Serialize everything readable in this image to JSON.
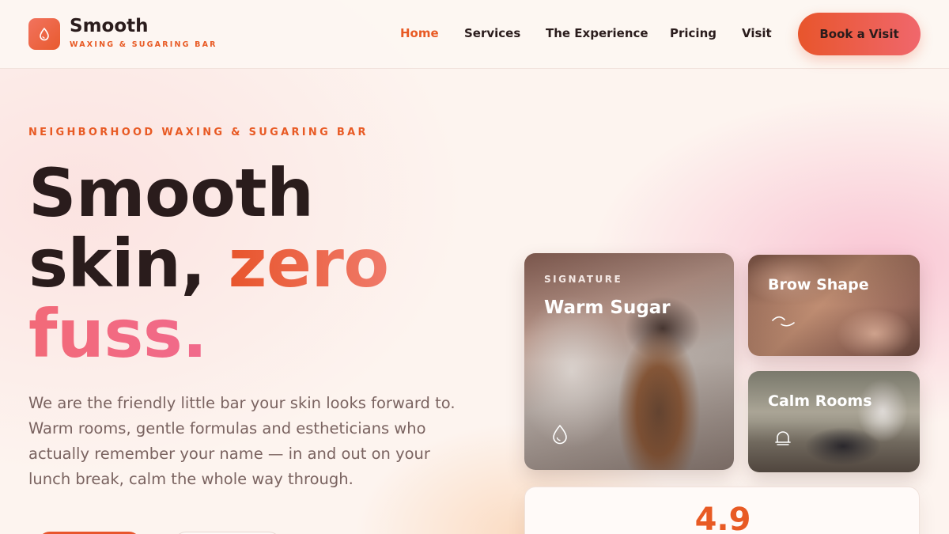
{
  "brand": {
    "name": "Smooth",
    "tagline": "WAXING & SUGARING BAR",
    "icon": "water-drop-icon"
  },
  "nav": {
    "items": [
      {
        "label": "Home",
        "active": true
      },
      {
        "label": "Services",
        "active": false
      },
      {
        "label": "The Experience",
        "active": false
      },
      {
        "label": "Pricing",
        "active": false
      },
      {
        "label": "Visit",
        "active": false
      }
    ],
    "cta_label": "Book a Visit"
  },
  "hero": {
    "eyebrow": "NEIGHBORHOOD WAXING & SUGARING BAR",
    "title_line1": "Smooth",
    "title_line2_a": "skin, ",
    "title_line2_b": "zero",
    "title_line3": "fuss.",
    "description": "We are the friendly little bar your skin looks forward to. Warm rooms, gentle formulas and estheticians who actually remember your name — in and out on your lunch break, calm the whole way through."
  },
  "cards": {
    "signature": {
      "kicker": "SIGNATURE",
      "title": "Warm Sugar",
      "icon": "water-drop-icon"
    },
    "brow": {
      "title": "Brow Shape",
      "icon": "eyebrow-icon"
    },
    "calm": {
      "title": "Calm Rooms",
      "icon": "bell-icon"
    }
  },
  "rating": {
    "value": "4.9"
  },
  "colors": {
    "accent": "#e85a24",
    "pink": "#f06a8a",
    "text": "#2a1c1c",
    "muted": "#7a6360",
    "background": "#fdf4ef"
  }
}
